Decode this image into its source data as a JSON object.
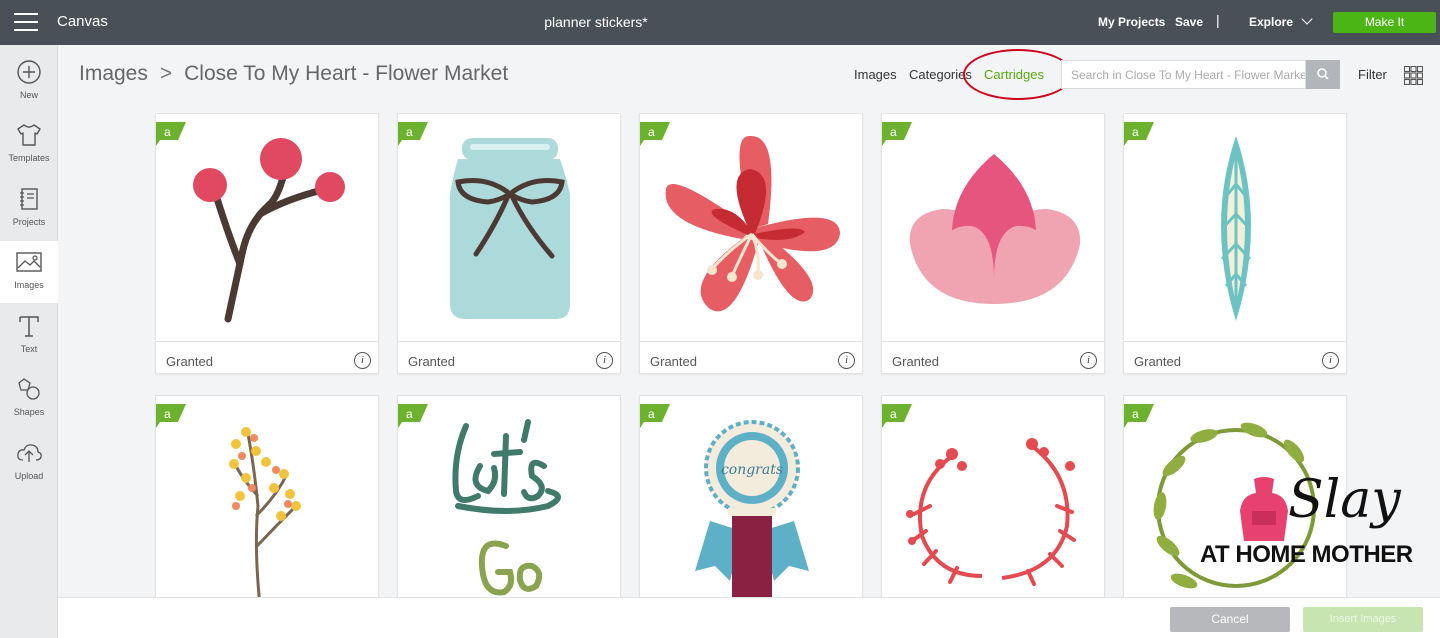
{
  "topbar": {
    "app_title": "Canvas",
    "project_title": "planner stickers*",
    "my_projects": "My Projects",
    "save": "Save",
    "separator": "|",
    "explore": "Explore",
    "make_it": "Make It"
  },
  "sidebar": {
    "items": [
      {
        "label": "New",
        "icon": "plus-circle-icon"
      },
      {
        "label": "Templates",
        "icon": "tshirt-icon"
      },
      {
        "label": "Projects",
        "icon": "notebook-icon"
      },
      {
        "label": "Images",
        "icon": "image-icon",
        "active": true
      },
      {
        "label": "Text",
        "icon": "text-t-icon"
      },
      {
        "label": "Shapes",
        "icon": "shapes-icon"
      },
      {
        "label": "Upload",
        "icon": "cloud-upload-icon"
      }
    ]
  },
  "header": {
    "breadcrumb_root": "Images",
    "breadcrumb_sep": ">",
    "breadcrumb_current": "Close To My Heart - Flower Market",
    "tab_images": "Images",
    "tab_categories": "Categories",
    "tab_cartridges": "Cartridges",
    "search_placeholder": "Search in Close To My Heart - Flower Market",
    "filter": "Filter"
  },
  "cards": [
    {
      "status": "Granted",
      "image": "red-berries-branch"
    },
    {
      "status": "Granted",
      "image": "mason-jar-with-bow"
    },
    {
      "status": "Granted",
      "image": "red-lily-flower"
    },
    {
      "status": "Granted",
      "image": "pink-lotus"
    },
    {
      "status": "Granted",
      "image": "teal-leaf"
    },
    {
      "image": "yellow-berry-twig"
    },
    {
      "image": "lets-go-lettering"
    },
    {
      "image": "congrats-ribbon-badge"
    },
    {
      "image": "red-floral-wreath"
    },
    {
      "image": "green-leaf-wreath"
    }
  ],
  "footer": {
    "cancel": "Cancel",
    "insert": "Insert Images"
  },
  "watermark": {
    "line1": "Slay",
    "line2": "AT HOME MOTHER"
  },
  "colors": {
    "topbar": "#4a5058",
    "accent_green": "#4ab514",
    "cartridges_tab": "#58a90f",
    "annotation_circle": "#d0021b"
  }
}
